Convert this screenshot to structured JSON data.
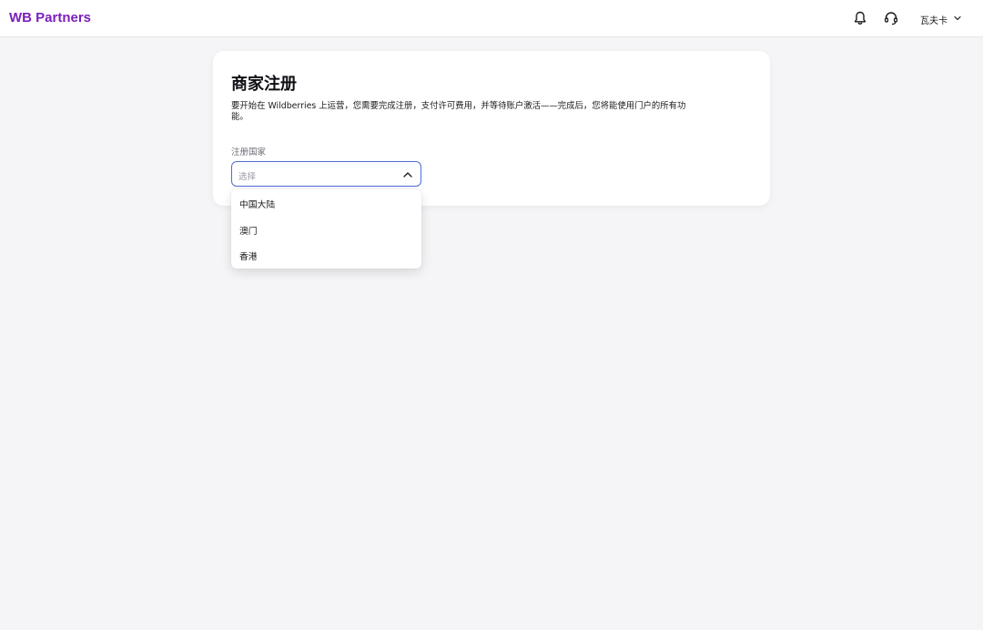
{
  "header": {
    "logo": "WB Partners",
    "bell_icon": "bell-icon",
    "support_icon": "headset-icon",
    "user_name": "瓦夫卡",
    "user_chevron": "chevron-down-icon"
  },
  "card": {
    "title": "商家注册",
    "description": "要开始在 Wildberries 上运营，您需要完成注册，支付许可费用，并等待账户激活——完成后，您将能使用门户的所有功能。"
  },
  "country_field": {
    "label": "注册国家",
    "placeholder": "选择",
    "chevron": "chevron-up-icon",
    "options": [
      "中国大陆",
      "澳门",
      "香港"
    ]
  },
  "colors": {
    "brand": "#7b1fbd",
    "focus_border": "#4d6bd9",
    "background": "#f5f5f7"
  }
}
